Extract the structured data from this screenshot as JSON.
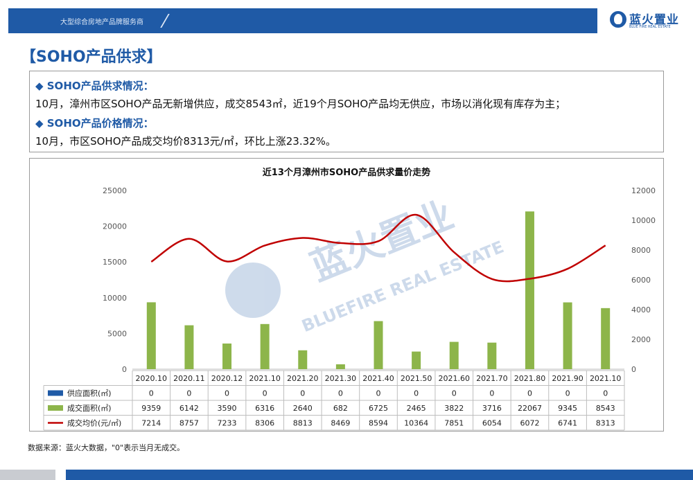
{
  "header": {
    "tagline": "大型综合房地产品牌服务商",
    "brand_cn": "蓝火置业",
    "brand_en": "BLUE FIRE REAL ESTATE"
  },
  "page_title": "【SOHO产品供求】",
  "info": {
    "supply_heading": "◆  SOHO产品供求情况：",
    "supply_text": "10月，漳州市区SOHO产品无新增供应，成交8543㎡，近19个月SOHO产品均无供应，市场以消化现有库存为主；",
    "price_heading": "◆  SOHO产品价格情况：",
    "price_text": "10月，市区SOHO产品成交均价8313元/㎡，环比上涨23.32%。"
  },
  "watermark": {
    "cn": "蓝火置业",
    "en": "BLUEFIRE REAL ESTATE"
  },
  "chart_data": {
    "type": "bar",
    "title": "近13个月漳州市SOHO产品供求量价走势",
    "categories": [
      "2020.10",
      "2020.11",
      "2020.12",
      "2021.10",
      "2021.20",
      "2021.30",
      "2021.40",
      "2021.50",
      "2021.60",
      "2021.70",
      "2021.80",
      "2021.90",
      "2021.10"
    ],
    "series": [
      {
        "name": "供应面积(㎡)",
        "type": "bar",
        "axis": "left",
        "color": "#1f5aa6",
        "values": [
          0,
          0,
          0,
          0,
          0,
          0,
          0,
          0,
          0,
          0,
          0,
          0,
          0
        ]
      },
      {
        "name": "成交面积(㎡)",
        "type": "bar",
        "axis": "left",
        "color": "#8db54a",
        "values": [
          9359,
          6142,
          3590,
          6316,
          2640,
          682,
          6725,
          2465,
          3822,
          3716,
          22067,
          9345,
          8543
        ]
      },
      {
        "name": "成交均价(元/㎡)",
        "type": "line",
        "axis": "right",
        "color": "#c00000",
        "values": [
          7214,
          8757,
          7233,
          8306,
          8813,
          8469,
          8594,
          10364,
          7851,
          6054,
          6072,
          6741,
          8313
        ]
      }
    ],
    "yleft": {
      "min": 0,
      "max": 25000,
      "ticks": [
        0,
        5000,
        10000,
        15000,
        20000,
        25000
      ]
    },
    "yright": {
      "min": 0,
      "max": 12000,
      "ticks": [
        0,
        2000,
        4000,
        6000,
        8000,
        10000,
        12000
      ]
    },
    "legend": "data-table below plot",
    "grid": false
  },
  "footnote": "数据来源：蓝火大数据，\"0\"表示当月无成交。"
}
